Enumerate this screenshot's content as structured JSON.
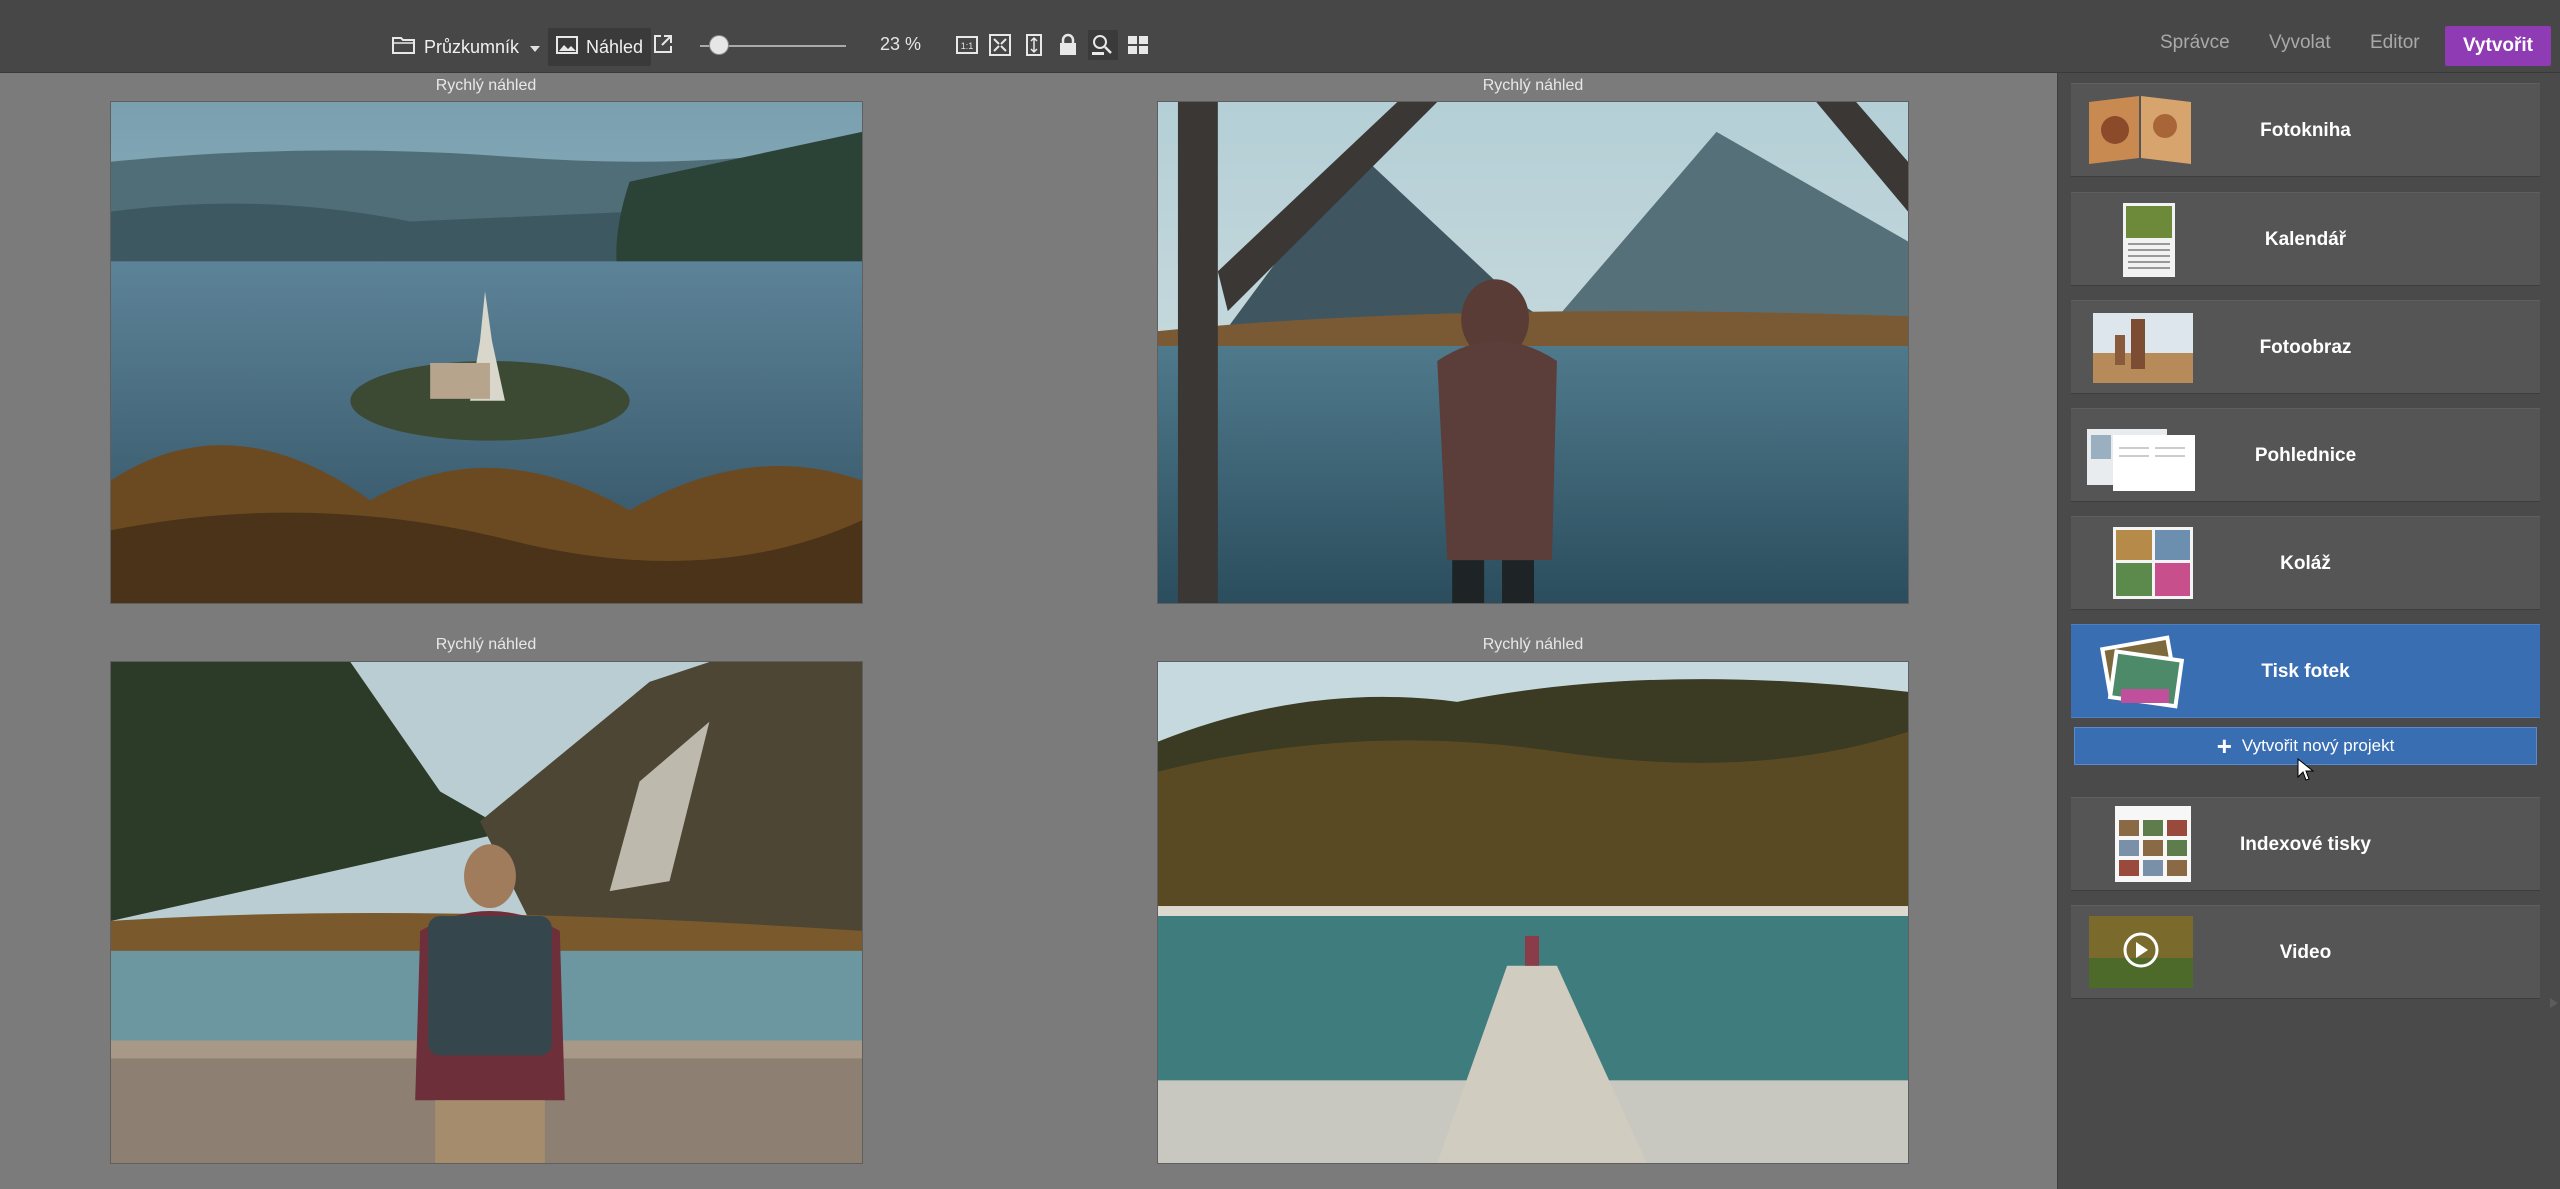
{
  "toolbar": {
    "browser_label": "Průzkumník",
    "preview_label": "Náhled",
    "zoom_value": "23 %",
    "zoom_level": 0.13
  },
  "modes": {
    "manager": "Správce",
    "develop": "Vyvolat",
    "editor": "Editor",
    "create": "Vytvořit"
  },
  "photos": [
    {
      "caption": "Rychlý náhled"
    },
    {
      "caption": "Rychlý náhled"
    },
    {
      "caption": "Rychlý náhled"
    },
    {
      "caption": "Rychlý náhled"
    }
  ],
  "panel": {
    "items": [
      {
        "label": "Fotokniha"
      },
      {
        "label": "Kalendář"
      },
      {
        "label": "Fotoobraz"
      },
      {
        "label": "Pohlednice"
      },
      {
        "label": "Koláž"
      },
      {
        "label": "Tisk fotek"
      },
      {
        "label": "Indexové tisky"
      },
      {
        "label": "Video"
      }
    ],
    "new_project_label": "Vytvořit nový projekt",
    "active_item": "Tisk fotek"
  },
  "colors": {
    "accent_create": "#8e3bb4",
    "active_blue": "#3a6eb3"
  }
}
